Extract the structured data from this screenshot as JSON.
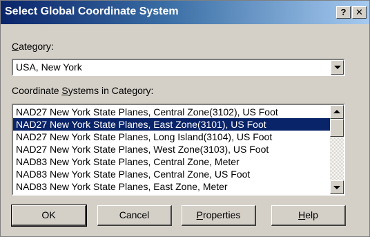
{
  "window": {
    "title": "Select Global Coordinate System",
    "help_glyph": "?",
    "close_glyph": "✕"
  },
  "category": {
    "label_accel": "C",
    "label_rest": "ategory:",
    "selected_value": "USA, New York"
  },
  "systems": {
    "label_pre": "Coordinate ",
    "label_accel": "S",
    "label_post": "ystems in Category:",
    "items": [
      "NAD27 New York State Planes, Central Zone(3102), US Foot",
      "NAD27 New York State Planes, East Zone(3101), US Foot",
      "NAD27 New York State Planes, Long Island(3104), US Foot",
      "NAD27 New York State Planes, West Zone(3103), US Foot",
      "NAD83 New York State Planes, Central Zone, Meter",
      "NAD83 New York State Planes, Central Zone, US Foot",
      "NAD83 New York State Planes, East Zone, Meter"
    ],
    "selected_index": 1
  },
  "buttons": {
    "ok": "OK",
    "cancel": "Cancel",
    "properties_accel": "P",
    "properties_rest": "roperties",
    "help_accel": "H",
    "help_rest": "elp"
  },
  "colors": {
    "selection": "#0a246a",
    "face": "#d4d0c8"
  }
}
